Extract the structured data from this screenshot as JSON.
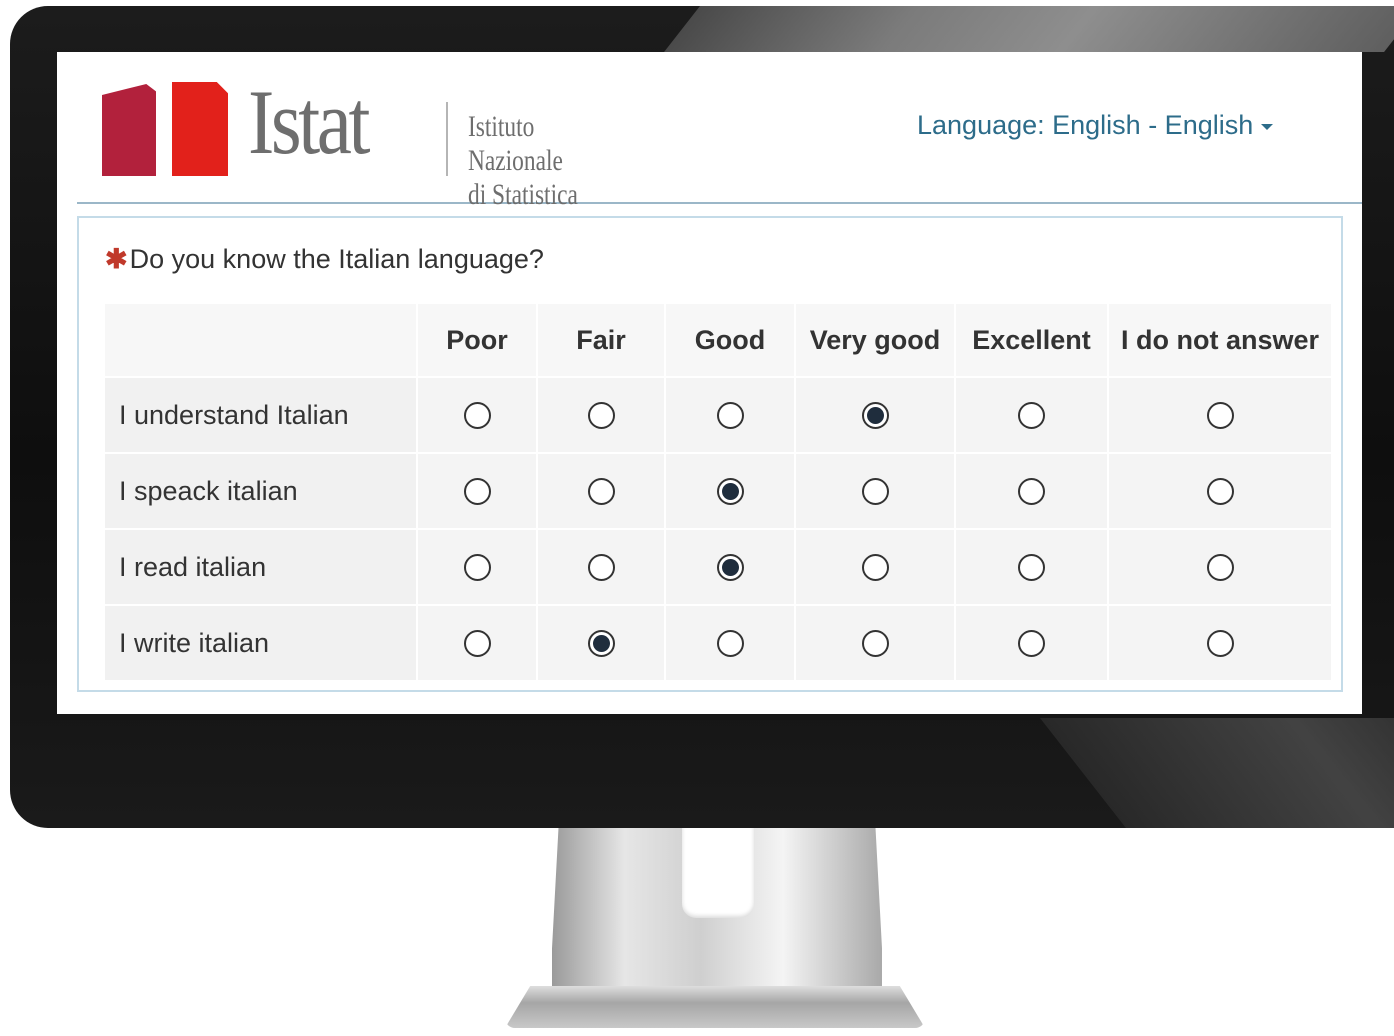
{
  "brand": {
    "name": "Istat",
    "subtitle_line1": "Istituto Nazionale",
    "subtitle_line2": "di Statistica",
    "colors": {
      "bar_dark": "#b2213c",
      "bar_light": "#e2211b",
      "wordmark": "#6e6e6e"
    }
  },
  "language_selector": {
    "label": "Language: English - English",
    "icon": "caret-down-icon"
  },
  "question": {
    "required_marker": "✱",
    "text": "Do you know the Italian language?"
  },
  "columns": [
    "Poor",
    "Fair",
    "Good",
    "Very good",
    "Excellent",
    "I do not answer"
  ],
  "rows": [
    {
      "label": "I understand Italian",
      "selected": "Very good"
    },
    {
      "label": "I speack italian",
      "selected": "Good"
    },
    {
      "label": "I read italian",
      "selected": "Good"
    },
    {
      "label": "I write italian",
      "selected": "Fair"
    }
  ],
  "colors": {
    "link": "#2d6c8a",
    "required": "#c0392b",
    "panel_border": "#c4dbe8"
  }
}
